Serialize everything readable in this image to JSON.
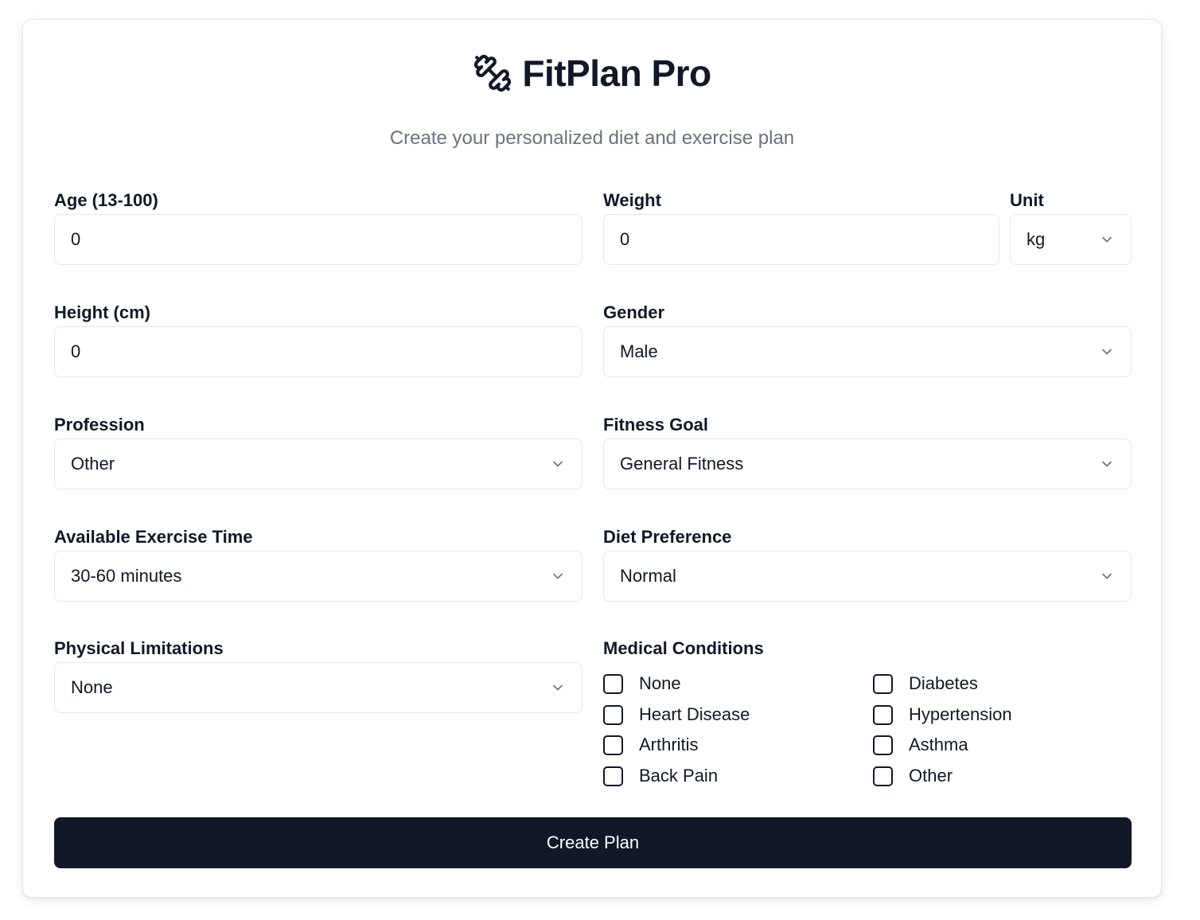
{
  "header": {
    "title": "FitPlan Pro",
    "subtitle": "Create your personalized diet and exercise plan",
    "logo_icon": "dumbbell-icon"
  },
  "form": {
    "age": {
      "label": "Age (13-100)",
      "value": "0"
    },
    "weight": {
      "label": "Weight",
      "value": "0"
    },
    "unit": {
      "label": "Unit",
      "value": "kg"
    },
    "height": {
      "label": "Height (cm)",
      "value": "0"
    },
    "gender": {
      "label": "Gender",
      "value": "Male"
    },
    "profession": {
      "label": "Profession",
      "value": "Other"
    },
    "fitness_goal": {
      "label": "Fitness Goal",
      "value": "General Fitness"
    },
    "exercise_time": {
      "label": "Available Exercise Time",
      "value": "30-60 minutes"
    },
    "diet_preference": {
      "label": "Diet Preference",
      "value": "Normal"
    },
    "physical_limitations": {
      "label": "Physical Limitations",
      "value": "None"
    },
    "medical_conditions": {
      "label": "Medical Conditions",
      "options": [
        "None",
        "Diabetes",
        "Heart Disease",
        "Hypertension",
        "Arthritis",
        "Asthma",
        "Back Pain",
        "Other"
      ]
    },
    "submit_label": "Create Plan"
  },
  "colors": {
    "primary": "#111827",
    "muted_text": "#6b7280",
    "border": "#e5e7eb"
  }
}
